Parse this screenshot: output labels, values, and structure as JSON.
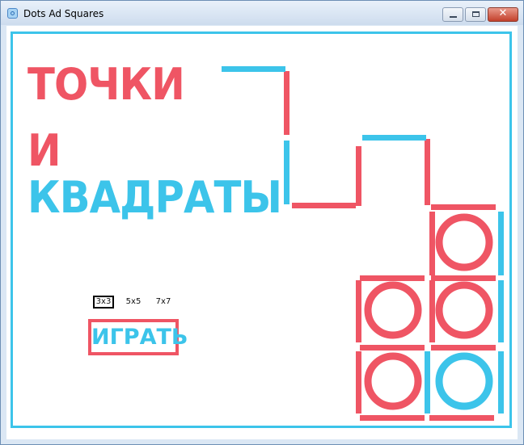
{
  "window": {
    "title": "Dots Ad Squares",
    "close_glyph": "✕"
  },
  "heading": {
    "line1": "ТОЧКИ",
    "line2": "И",
    "line3": "КВАДРАТЫ"
  },
  "grid_sizes": [
    {
      "label": "3x3",
      "selected": true
    },
    {
      "label": "5x5",
      "selected": false
    },
    {
      "label": "7x7",
      "selected": false
    }
  ],
  "play_button": {
    "label": "ИГРАТЬ"
  },
  "colors": {
    "red": "#ef5564",
    "blue": "#3cc4ea"
  }
}
